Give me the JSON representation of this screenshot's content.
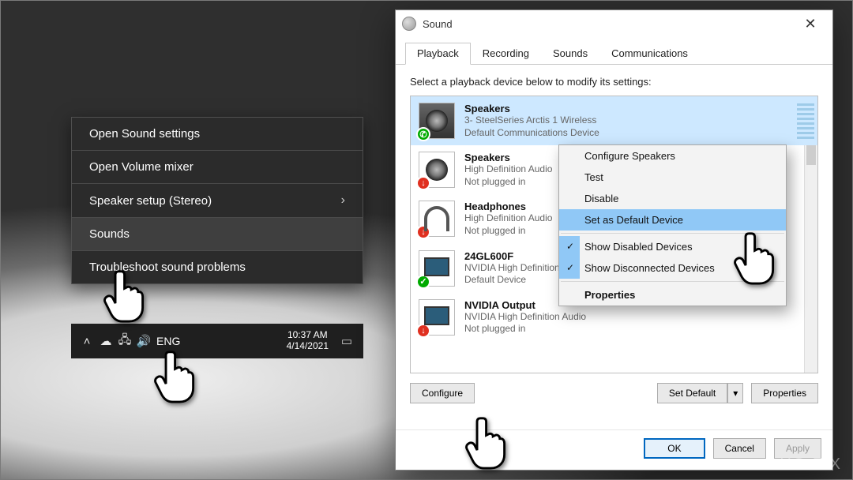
{
  "context_menu": {
    "open_settings": "Open Sound settings",
    "open_mixer": "Open Volume mixer",
    "speaker_setup": "Speaker setup (Stereo)",
    "sounds": "Sounds",
    "troubleshoot": "Troubleshoot sound problems"
  },
  "taskbar": {
    "lang": "ENG",
    "time": "10:37 AM",
    "date": "4/14/2021"
  },
  "sound_window": {
    "title": "Sound",
    "tabs": {
      "playback": "Playback",
      "recording": "Recording",
      "sounds": "Sounds",
      "communications": "Communications"
    },
    "instruction": "Select a playback device below to modify its settings:",
    "devices": [
      {
        "name": "Speakers",
        "sub1": "3- SteelSeries Arctis 1 Wireless",
        "sub2": "Default Communications Device"
      },
      {
        "name": "Speakers",
        "sub1": "High Definition Audio",
        "sub2": "Not plugged in"
      },
      {
        "name": "Headphones",
        "sub1": "High Definition Audio",
        "sub2": "Not plugged in"
      },
      {
        "name": "24GL600F",
        "sub1": "NVIDIA High Definition Audio",
        "sub2": "Default Device"
      },
      {
        "name": "NVIDIA Output",
        "sub1": "NVIDIA High Definition Audio",
        "sub2": "Not plugged in"
      }
    ],
    "configure": "Configure",
    "set_default": "Set Default",
    "properties": "Properties",
    "ok": "OK",
    "cancel": "Cancel",
    "apply": "Apply"
  },
  "device_menu": {
    "configure_speakers": "Configure Speakers",
    "test": "Test",
    "disable": "Disable",
    "set_default": "Set as Default Device",
    "show_disabled": "Show Disabled Devices",
    "show_disconnected": "Show Disconnected Devices",
    "properties": "Properties"
  },
  "watermark": "UG  FIX"
}
